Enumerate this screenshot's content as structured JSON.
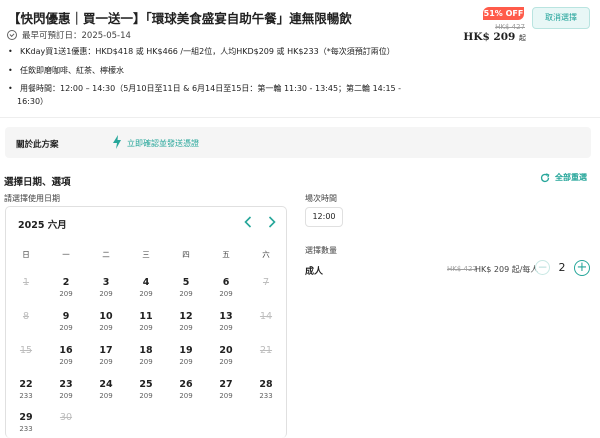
{
  "title": "【快閃優惠｜買一送一】「環球美食盛宴自助午餐」連無限暢飲",
  "booking_date": "最早可預訂日：2025-05-14",
  "bullets": [
    "KKday買1送1優惠：HKD$418 或 HK$466 /一組2位，人均HKD$209 或 HK$233（*每次須預訂兩位）",
    "任飲即磨咖啡、紅茶、檸檬水",
    "用餐時間：12:00 – 14:30（5月10日至11日 & 6月14日至15日：第一輪 11:30 - 13:45；第二輪 14:15 -",
    "16:30）"
  ],
  "badge": "51% OFF",
  "original_price": "HK$ 427",
  "price": "HK$ 209",
  "price_suffix": "起",
  "cancel_label": "取消選擇",
  "about": {
    "title": "關於此方案",
    "link": "立即確認並發送憑證"
  },
  "section_title": "選擇日期、選項",
  "reset_label": "全部重選",
  "date_label": "請選擇使用日期",
  "calendar": {
    "month": "2025 六月",
    "weekdays": [
      "日",
      "一",
      "二",
      "三",
      "四",
      "五",
      "六"
    ],
    "weeks": [
      [
        {
          "d": "1",
          "dis": true
        },
        {
          "d": "2",
          "p": "209"
        },
        {
          "d": "3",
          "p": "209"
        },
        {
          "d": "4",
          "p": "209"
        },
        {
          "d": "5",
          "p": "209"
        },
        {
          "d": "6",
          "p": "209"
        },
        {
          "d": "7",
          "dis": true
        }
      ],
      [
        {
          "d": "8",
          "dis": true
        },
        {
          "d": "9",
          "p": "209"
        },
        {
          "d": "10",
          "p": "209"
        },
        {
          "d": "11",
          "p": "209"
        },
        {
          "d": "12",
          "p": "209"
        },
        {
          "d": "13",
          "p": "209"
        },
        {
          "d": "14",
          "dis": true
        }
      ],
      [
        {
          "d": "15",
          "dis": true
        },
        {
          "d": "16",
          "p": "209"
        },
        {
          "d": "17",
          "p": "209"
        },
        {
          "d": "18",
          "p": "209"
        },
        {
          "d": "19",
          "p": "209"
        },
        {
          "d": "20",
          "p": "209"
        },
        {
          "d": "21",
          "dis": true
        }
      ],
      [
        {
          "d": "22",
          "p": "233"
        },
        {
          "d": "23",
          "p": "209"
        },
        {
          "d": "24",
          "p": "209"
        },
        {
          "d": "25",
          "p": "209"
        },
        {
          "d": "26",
          "p": "209"
        },
        {
          "d": "27",
          "p": "209"
        },
        {
          "d": "28",
          "p": "233"
        }
      ],
      [
        {
          "d": "29",
          "p": "233"
        },
        {
          "d": "30",
          "dis": true
        }
      ]
    ]
  },
  "time": {
    "label": "場次時間",
    "value": "12:00"
  },
  "quantity": {
    "label": "選擇數量",
    "adult_label": "成人",
    "original": "HK$ 427",
    "price": "HK$ 209 起/每人",
    "value": "2"
  },
  "colors": {
    "accent": "#26a69a",
    "badge": "#ff5b4a"
  }
}
